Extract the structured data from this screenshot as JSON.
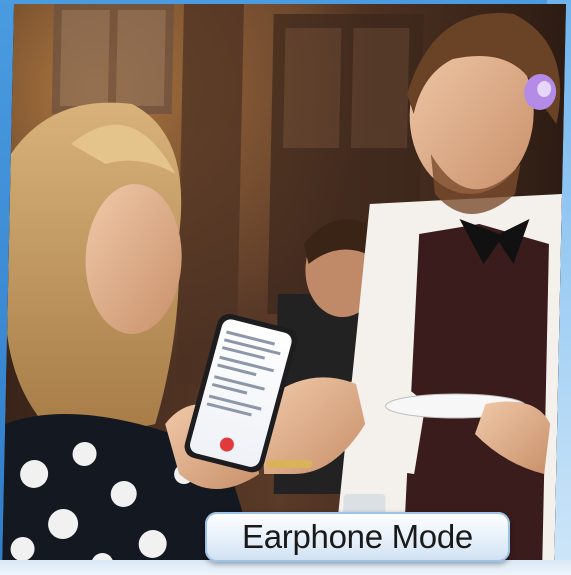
{
  "caption": {
    "text": "Earphone Mode"
  },
  "phone_screen": {
    "accent_color": "#e23a3a"
  },
  "colors": {
    "frame_blue": "#3f8fd6",
    "earphone_purple": "#b58be8",
    "caption_bg": "#e6f0fa"
  }
}
